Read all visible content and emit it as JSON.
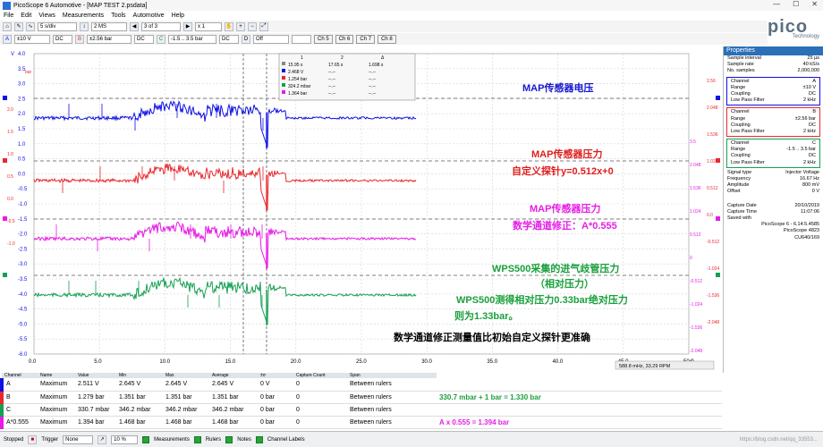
{
  "window": {
    "title": "PicoScope 6 Automotive - [MAP TEST 2.psdata]",
    "controls": [
      "—",
      "☐",
      "✕"
    ]
  },
  "menu": [
    "File",
    "Edit",
    "Views",
    "Measurements",
    "Tools",
    "Automotive",
    "Help"
  ],
  "logo": {
    "name": "pico",
    "sub": "Technology"
  },
  "toolbar1": {
    "timebase": "5 s/div",
    "samples": "2 MS",
    "buffer": "3 of 3",
    "zoom": "x 1"
  },
  "toolbar2": {
    "chA_range": "±10 V",
    "chA_coupling": "DC",
    "chB_range": "±2.56 bar",
    "chB_coupling": "DC",
    "chC_range": "-1.5 .. 3.5 bar",
    "chC_coupling": "DC",
    "chD": "D",
    "chD_state": "Off",
    "ch_buttons": [
      "Ch 5",
      "Ch 6",
      "Ch 7",
      "Ch 8"
    ]
  },
  "colors": {
    "A": "#1010e6",
    "B": "#e8282e",
    "math": "#e81ae6",
    "C": "#14a050",
    "blue_text": "#1717d0",
    "red_text": "#e01e1e",
    "pink_text": "#e61ee6",
    "green_text": "#1aa03c"
  },
  "axes": {
    "leftV": {
      "unit": "V",
      "ticks": [
        "4.0",
        "3.5",
        "3.0",
        "2.5",
        "2.0",
        "1.5",
        "1.0",
        "0.5",
        "0.0",
        "-0.5",
        "-1.0",
        "-1.5",
        "-2.0",
        "-2.5",
        "-3.0",
        "-3.5",
        "-4.0",
        "-4.5",
        "-5.0",
        "-5.5",
        "-6.0"
      ]
    },
    "leftBar": {
      "unit": "bar",
      "ticks": [
        "2.0",
        "1.5",
        "1.0",
        "0.5",
        "0.0",
        "-0.5",
        "-1.0"
      ]
    },
    "rightB": {
      "ticks": [
        "2.56",
        "2.048",
        "1.536",
        "1.024",
        "0.512",
        "0.0",
        "-0.512",
        "-1.024",
        "-1.536",
        "-2.048"
      ]
    },
    "rightC": {
      "ticks": [
        "3.5",
        "2.048",
        "1.536",
        "1.024",
        "0.512",
        "0",
        "-0.512",
        "-1.024",
        "-1.536",
        "-2.048"
      ]
    },
    "rightC2": {
      "ticks": [
        "2.56",
        "2.048",
        "1.536",
        "1.024",
        "0.512",
        "0.0",
        "-0.512",
        "-1.024"
      ]
    },
    "x": {
      "ticks": [
        "0.0",
        "5.0",
        "10.0",
        "15.0",
        "20.0",
        "25.0",
        "30.0",
        "35.0",
        "40.0",
        "45.0",
        "50.0"
      ],
      "unit": "s"
    }
  },
  "ruler_table": {
    "headers": [
      "1",
      "2",
      "Δ"
    ],
    "rows": [
      [
        "15.95 s",
        "17.65 s",
        "1.698 s"
      ],
      [
        "2.468 V",
        "--.--",
        "--.--"
      ],
      [
        "1.254 bar",
        "--.--",
        "--.--"
      ],
      [
        "324.2 mbar",
        "--.--",
        "--.--"
      ],
      [
        "1.364 bar",
        "--.--",
        "--.--"
      ]
    ],
    "row_colors": [
      "#888888",
      "#1010e6",
      "#e8282e",
      "#14a050",
      "#e81ae6"
    ]
  },
  "annotations": [
    {
      "text": "MAP传感器电压",
      "color": "#1717d0"
    },
    {
      "text": "MAP传感器压力",
      "color": "#e01e1e"
    },
    {
      "text": "自定义探针y=0.512x+0",
      "color": "#e01e1e"
    },
    {
      "text": "MAP传感器压力",
      "color": "#e61ee6"
    },
    {
      "text": "数学通道修正：A*0.555",
      "color": "#e61ee6"
    },
    {
      "text": "WPS500采集的进气歧管压力",
      "color": "#1aa03c"
    },
    {
      "text": "（相对压力）",
      "color": "#1aa03c"
    },
    {
      "text": "WPS500测得相对压力0.33bar绝对压力",
      "color": "#1aa03c"
    },
    {
      "text": "则为1.33bar。",
      "color": "#1aa03c"
    },
    {
      "text": "数学通道修正测量值比初始自定义探针更准确",
      "color": "#000000"
    }
  ],
  "freq_readout": "588.8 mHz, 33.29 RPM",
  "properties": {
    "title": "Properties",
    "general": [
      [
        "Sample interval",
        "25 µs"
      ],
      [
        "Sample rate",
        "40 kS/s"
      ],
      [
        "No. samples",
        "2,000,000"
      ]
    ],
    "channels": [
      {
        "rows": [
          [
            "Channel",
            "A"
          ],
          [
            "Range",
            "±10 V"
          ],
          [
            "Coupling",
            "DC"
          ],
          [
            "Low Pass Filter",
            "2 kHz"
          ]
        ],
        "color": "#1010e6"
      },
      {
        "rows": [
          [
            "Channel",
            "B"
          ],
          [
            "Range",
            "±2.56 bar"
          ],
          [
            "Coupling",
            "DC"
          ],
          [
            "Low Pass Filter",
            "2 kHz"
          ]
        ],
        "color": "#e8282e"
      },
      {
        "rows": [
          [
            "Channel",
            "C"
          ],
          [
            "Range",
            "-1.5 .. 3.5 bar"
          ],
          [
            "Coupling",
            "DC"
          ],
          [
            "Low Pass Filter",
            "2 kHz"
          ]
        ],
        "color": "#14a050"
      }
    ],
    "signal": [
      [
        "Signal type",
        "Injector Voltage"
      ],
      [
        "Frequency",
        "16.67 Hz"
      ],
      [
        "Amplitude",
        "800 mV"
      ],
      [
        "Offset",
        "0 V"
      ]
    ],
    "capture": [
      [
        "Capture Date",
        "20/10/2019"
      ],
      [
        "Capture Time",
        "11:07:06"
      ],
      [
        "Saved with",
        ""
      ],
      [
        "",
        "PicoScope 6 - 6.14.5.4585"
      ],
      [
        "",
        "PicoScope 4823"
      ],
      [
        "",
        "CU640/169"
      ]
    ]
  },
  "measurements": {
    "headers": [
      "Channel",
      "Name",
      "Value",
      "Min",
      "Max",
      "Average",
      "±σ",
      "Capture Count",
      "Span"
    ],
    "rows": [
      [
        "A",
        "Maximum",
        "2.511 V",
        "2.645 V",
        "2.645 V",
        "2.645 V",
        "0 V",
        "0",
        "Between rulers"
      ],
      [
        "B",
        "Maximum",
        "1.279 bar",
        "1.351 bar",
        "1.351 bar",
        "1.351 bar",
        "0 bar",
        "0",
        "Between rulers"
      ],
      [
        "C",
        "Maximum",
        "330.7 mbar",
        "346.2 mbar",
        "346.2 mbar",
        "346.2 mbar",
        "0 bar",
        "0",
        "Between rulers"
      ],
      [
        "A*0.555",
        "Maximum",
        "1.394 bar",
        "1.468 bar",
        "1.468 bar",
        "1.468 bar",
        "0 bar",
        "0",
        "Between rulers"
      ]
    ],
    "row_colors": [
      "#1010e6",
      "#e8282e",
      "#14a050",
      "#e81ae6"
    ],
    "note_green": "330.7 mbar + 1 bar = 1.330 bar",
    "note_pink": "A x 0.555 = 1.394 bar"
  },
  "statusbar": {
    "stopped": "Stopped",
    "trigger": "Trigger",
    "trigger_mode": "None",
    "trig_level": "10 %",
    "measurements": "Measurements",
    "rulers": "Rulers",
    "notes": "Notes",
    "channel_labels": "Channel Labels",
    "watermark": "https://blog.csdn.net/qq_33553..."
  }
}
